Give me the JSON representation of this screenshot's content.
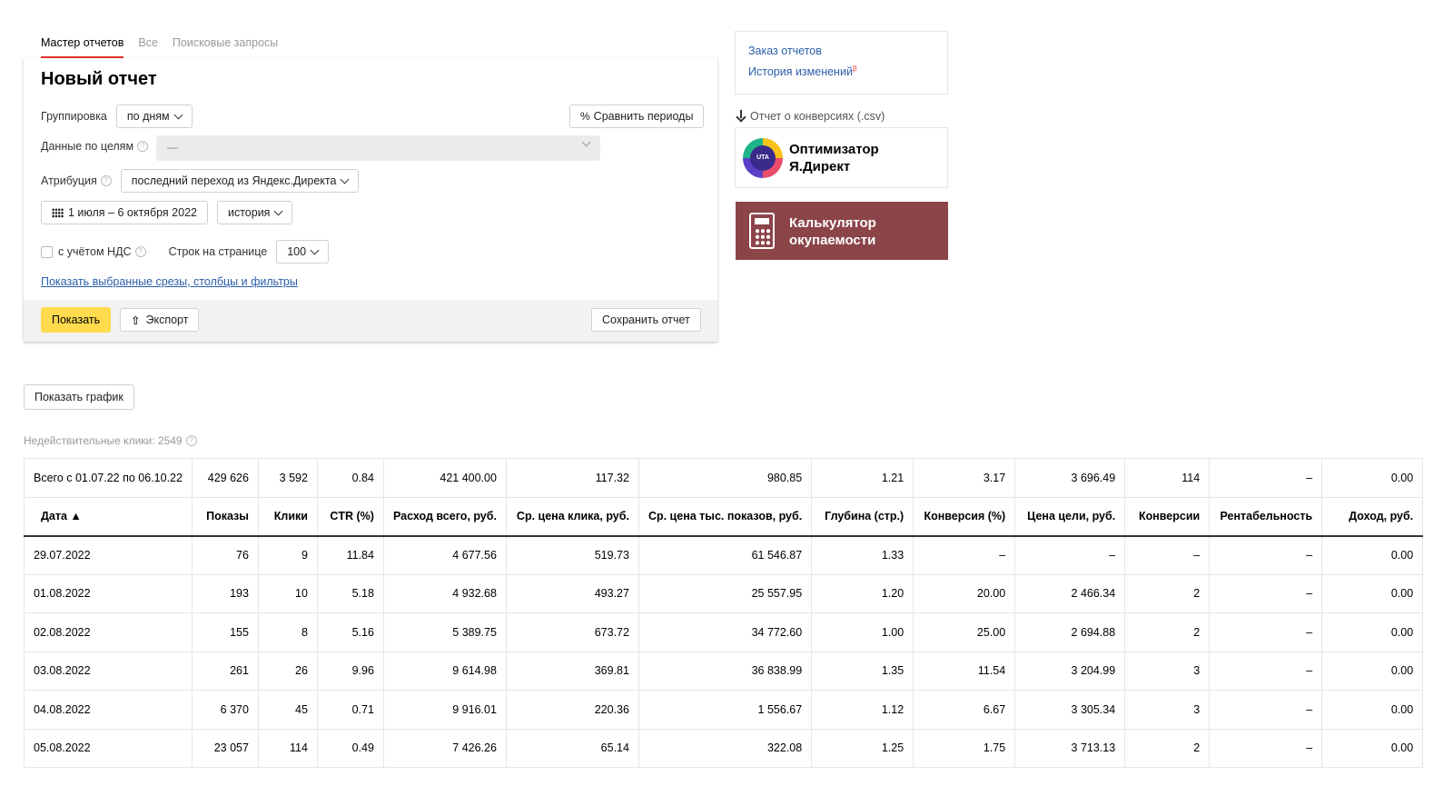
{
  "tabs": [
    "Мастер отчетов",
    "Все",
    "Поисковые запросы"
  ],
  "report": {
    "title": "Новый отчет",
    "grouping_label": "Группировка",
    "grouping_value": "по дням",
    "compare_button": "Сравнить периоды",
    "goals_label": "Данные по целям",
    "goals_value": "—",
    "attribution_label": "Атрибуция",
    "attribution_value": "последний переход из Яндекс.Директа",
    "date_range": "1 июля – 6 октября 2022",
    "history_value": "история",
    "vat_label": "с учётом НДС",
    "rows_label": "Строк на странице",
    "rows_value": "100",
    "show_selected_link": "Показать выбранные срезы, столбцы и фильтры",
    "show_button": "Показать",
    "export_button": "Экспорт",
    "save_button": "Сохранить отчет"
  },
  "right": {
    "order_link": "Заказ отчетов",
    "history_link": "История изменений",
    "history_badge": "β",
    "csv_link": "Отчет о конверсиях (.csv)",
    "uta_logo_text": "UTA",
    "optimizer_title_1": "Оптимизатор",
    "optimizer_title_2": "Я.Директ",
    "calc_title_1": "Калькулятор",
    "calc_title_2": "окупаемости"
  },
  "show_chart_button": "Показать график",
  "invalid_clicks": "Недействительные клики: 2549",
  "table": {
    "total": [
      "Всего с 01.07.22 по 06.10.22",
      "429 626",
      "3 592",
      "0.84",
      "421 400.00",
      "117.32",
      "980.85",
      "1.21",
      "3.17",
      "3 696.49",
      "114",
      "–",
      "0.00"
    ],
    "headers": [
      "Дата ▲",
      "Показы",
      "Клики",
      "CTR (%)",
      "Расход всего, руб.",
      "Ср. цена клика, руб.",
      "Ср. цена тыс. показов, руб.",
      "Глубина (стр.)",
      "Конверсия (%)",
      "Цена цели, руб.",
      "Конверсии",
      "Рентабельность",
      "Доход, руб."
    ],
    "rows": [
      [
        "29.07.2022",
        "76",
        "9",
        "11.84",
        "4 677.56",
        "519.73",
        "61 546.87",
        "1.33",
        "–",
        "–",
        "–",
        "–",
        "0.00"
      ],
      [
        "01.08.2022",
        "193",
        "10",
        "5.18",
        "4 932.68",
        "493.27",
        "25 557.95",
        "1.20",
        "20.00",
        "2 466.34",
        "2",
        "–",
        "0.00"
      ],
      [
        "02.08.2022",
        "155",
        "8",
        "5.16",
        "5 389.75",
        "673.72",
        "34 772.60",
        "1.00",
        "25.00",
        "2 694.88",
        "2",
        "–",
        "0.00"
      ],
      [
        "03.08.2022",
        "261",
        "26",
        "9.96",
        "9 614.98",
        "369.81",
        "36 838.99",
        "1.35",
        "11.54",
        "3 204.99",
        "3",
        "–",
        "0.00"
      ],
      [
        "04.08.2022",
        "6 370",
        "45",
        "0.71",
        "9 916.01",
        "220.36",
        "1 556.67",
        "1.12",
        "6.67",
        "3 305.34",
        "3",
        "–",
        "0.00"
      ],
      [
        "05.08.2022",
        "23 057",
        "114",
        "0.49",
        "7 426.26",
        "65.14",
        "322.08",
        "1.25",
        "1.75",
        "3 713.13",
        "2",
        "–",
        "0.00"
      ]
    ]
  }
}
